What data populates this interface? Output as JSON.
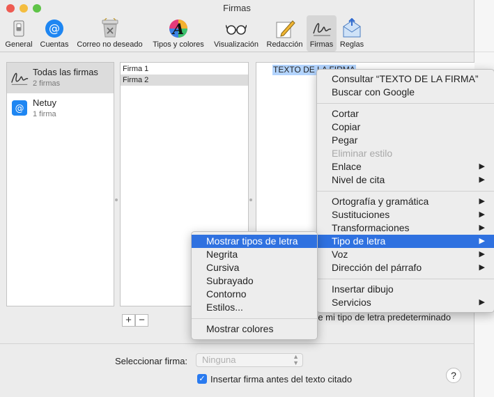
{
  "window": {
    "title": "Firmas"
  },
  "toolbar": {
    "items": [
      {
        "label": "General",
        "icon": "switch-icon"
      },
      {
        "label": "Cuentas",
        "icon": "at-icon"
      },
      {
        "label": "Correo no deseado",
        "icon": "junk-trash-icon"
      },
      {
        "label": "Tipos y colores",
        "icon": "font-color-icon"
      },
      {
        "label": "Visualización",
        "icon": "glasses-icon"
      },
      {
        "label": "Redacción",
        "icon": "compose-icon"
      },
      {
        "label": "Firmas",
        "icon": "signature-icon"
      },
      {
        "label": "Reglas",
        "icon": "rules-icon"
      }
    ],
    "active": "Firmas"
  },
  "accounts": [
    {
      "name": "Todas las firmas",
      "count": "2 firmas"
    },
    {
      "name": "Netuy",
      "count": "1 firma"
    }
  ],
  "signatures": [
    "Firma 1",
    "Firma 2"
  ],
  "preview": {
    "text": "TEXTO DE LA FIRMA",
    "default_font_text": "re mi tipo de letra predeterminado"
  },
  "buttons": {
    "add": "+",
    "remove": "−"
  },
  "footer": {
    "select_label": "Seleccionar firma:",
    "select_value": "Ninguna",
    "checkbox_label": "Insertar firma antes del texto citado",
    "checkbox_checked": true,
    "help": "?"
  },
  "context_menu": {
    "items": [
      "Consultar “TEXTO DE LA FIRMA”",
      "Buscar con Google",
      "Cortar",
      "Copiar",
      "Pegar",
      "Eliminar estilo",
      "Enlace",
      "Nivel de cita",
      "Ortografía y gramática",
      "Sustituciones",
      "Transformaciones",
      "Tipo de letra",
      "Voz",
      "Dirección del párrafo",
      "Insertar dibujo",
      "Servicios"
    ],
    "highlighted": "Tipo de letra"
  },
  "font_submenu": {
    "items": [
      "Mostrar tipos de letra",
      "Negrita",
      "Cursiva",
      "Subrayado",
      "Contorno",
      "Estilos...",
      "Mostrar colores"
    ],
    "highlighted": "Mostrar tipos de letra"
  },
  "colors": {
    "accent": "#2f71e0",
    "selection": "#b3d4fe",
    "close": "#ee5b52",
    "minimize": "#f4bd3f",
    "zoom": "#5fc448"
  }
}
